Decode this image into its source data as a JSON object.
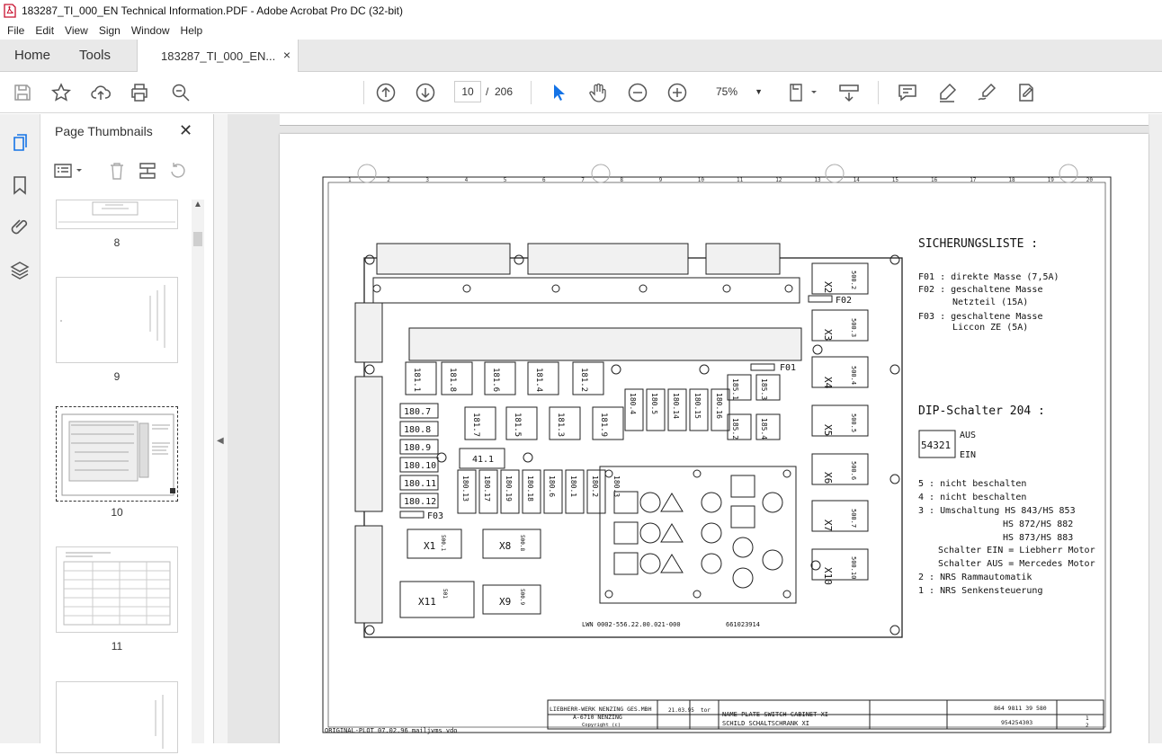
{
  "window": {
    "title": "183287_TI_000_EN Technical Information.PDF - Adobe Acrobat Pro DC (32-bit)"
  },
  "menu": [
    "File",
    "Edit",
    "View",
    "Sign",
    "Window",
    "Help"
  ],
  "tabs": {
    "home": "Home",
    "tools": "Tools",
    "document": "183287_TI_000_EN...",
    "close": "×"
  },
  "toolbar": {
    "page_current": "10",
    "page_separator": "/",
    "page_total": "206",
    "zoom": "75%"
  },
  "panel": {
    "title": "Page Thumbnails",
    "close": "✕",
    "thumbnails": [
      {
        "label": "8"
      },
      {
        "label": "9"
      },
      {
        "label": "10"
      },
      {
        "label": "11"
      }
    ]
  },
  "drawing": {
    "fuse_list_title": "SICHERUNGSLISTE :",
    "fuse_lines": [
      "F01 : direkte Masse (7,5A)",
      "F02 : geschaltene Masse",
      "Netzteil (15A)",
      "F03 : geschaltene Masse",
      "Liccon ZE (5A)"
    ],
    "dip_title": "DIP-Schalter 204 :",
    "dip_digits": "54321",
    "dip_aus": "AUS",
    "dip_ein": "EIN",
    "dip_lines": [
      "5 : nicht beschalten",
      "4 : nicht beschalten",
      "3 : Umschaltung HS 843/HS 853",
      "HS 872/HS 882",
      "HS 873/HS 883",
      "Schalter EIN = Liebherr Motor",
      "Schalter AUS = Mercedes Motor",
      "2 : NRS Rammautomatik",
      "1 : NRS Senkensteuerung"
    ],
    "fuse_labels": {
      "f01": "F01",
      "f02": "F02",
      "f03": "F03"
    },
    "connectors_right": [
      "X2",
      "X3",
      "X4",
      "X5",
      "X6",
      "X7",
      "X10"
    ],
    "connectors_right_codes": [
      "500.2",
      "500.3",
      "500.4",
      "500.5",
      "500.6",
      "500.7",
      "500.10"
    ],
    "connectors_bottom": [
      "X1",
      "X8",
      "X11",
      "X9"
    ],
    "connectors_bottom_codes": [
      "500.1",
      "500.8",
      "501",
      "500.9"
    ],
    "relays_top": [
      "181.1",
      "181.8",
      "181.6",
      "181.4",
      "181.2"
    ],
    "relays_left": [
      "180.7",
      "180.8",
      "180.9",
      "180.10",
      "180.11",
      "180.12"
    ],
    "relays_mid": [
      "181.7",
      "181.5",
      "181.3",
      "181.9"
    ],
    "relays_vertical": [
      "180.4",
      "180.5",
      "180.14",
      "180.15",
      "180.16"
    ],
    "relays_bottom": [
      "180.13",
      "180.17",
      "180.19",
      "180.18",
      "180.6",
      "180.1",
      "180.2",
      "180.3"
    ],
    "relays_185": [
      "185.1",
      "185.3",
      "185.2",
      "185.4"
    ],
    "relay_411": "41.1",
    "part_number_left": "LWN 0002-556.22.00.021-000",
    "part_number_right": "661023914",
    "company": "LIEBHERR-WERK NENZING GES.MBH",
    "company_address": "A-6710 NENZING",
    "copyright": "Copyright (c)",
    "issued_date": "21.03.95",
    "issuer": "tor",
    "name_line1": "NAME PLATE SWITCH CABINET XI",
    "name_line2": "SCHILD SCHALTSCHRANK XI",
    "drawing_no": "864 9811 39 580",
    "id_no": "954254303",
    "sheet": "1",
    "sheets": "2",
    "plot_note": "ORIGINAL-PLOT 07.02.96 mailjvms vdo",
    "grid_numbers": [
      "1",
      "2",
      "3",
      "4",
      "5",
      "6",
      "7",
      "8",
      "9",
      "10",
      "11",
      "12",
      "13",
      "14",
      "15",
      "16",
      "17",
      "18",
      "19",
      "20"
    ]
  }
}
